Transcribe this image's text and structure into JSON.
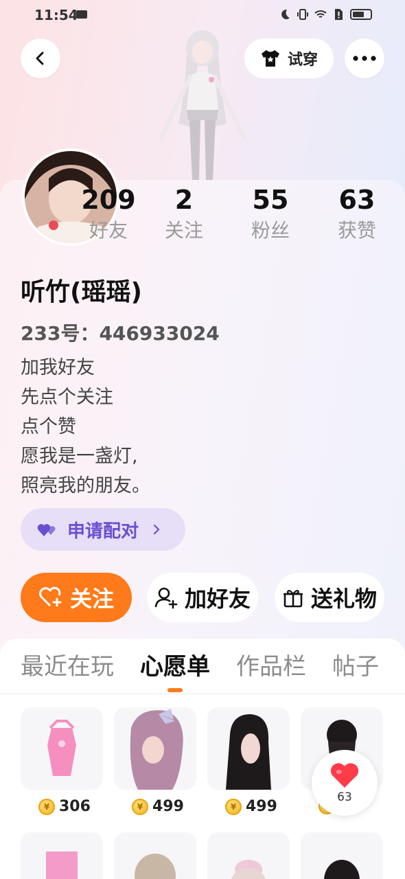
{
  "status_bar": {
    "time": "11:54"
  },
  "header": {
    "try_on_label": "试穿"
  },
  "profile": {
    "name": "听竹(瑶瑶)",
    "uid_line": "233号：446933024",
    "bio": [
      "加我好友",
      "先点个关注",
      "点个赞",
      "愿我是一盏灯,",
      "照亮我的朋友。"
    ],
    "stats": [
      {
        "value": "209",
        "label": "好友"
      },
      {
        "value": "2",
        "label": "关注"
      },
      {
        "value": "55",
        "label": "粉丝"
      },
      {
        "value": "63",
        "label": "获赞"
      }
    ],
    "match_label": "申请配对"
  },
  "actions": {
    "follow": "关注",
    "add_friend": "加好友",
    "send_gift": "送礼物"
  },
  "tabs": [
    "最近在玩",
    "心愿单",
    "作品栏",
    "帖子"
  ],
  "active_tab": "心愿单",
  "wishlist": [
    {
      "price": "306",
      "item": "pink top"
    },
    {
      "price": "499",
      "item": "lavender bow hair"
    },
    {
      "price": "499",
      "item": "black long hair"
    },
    {
      "price": "",
      "item": "black bun hair"
    }
  ],
  "floating_like": {
    "count": "63"
  },
  "colors": {
    "accent": "#ff7a1a",
    "match_purple": "#6a4fd0",
    "like_red": "#ff3b4a"
  }
}
